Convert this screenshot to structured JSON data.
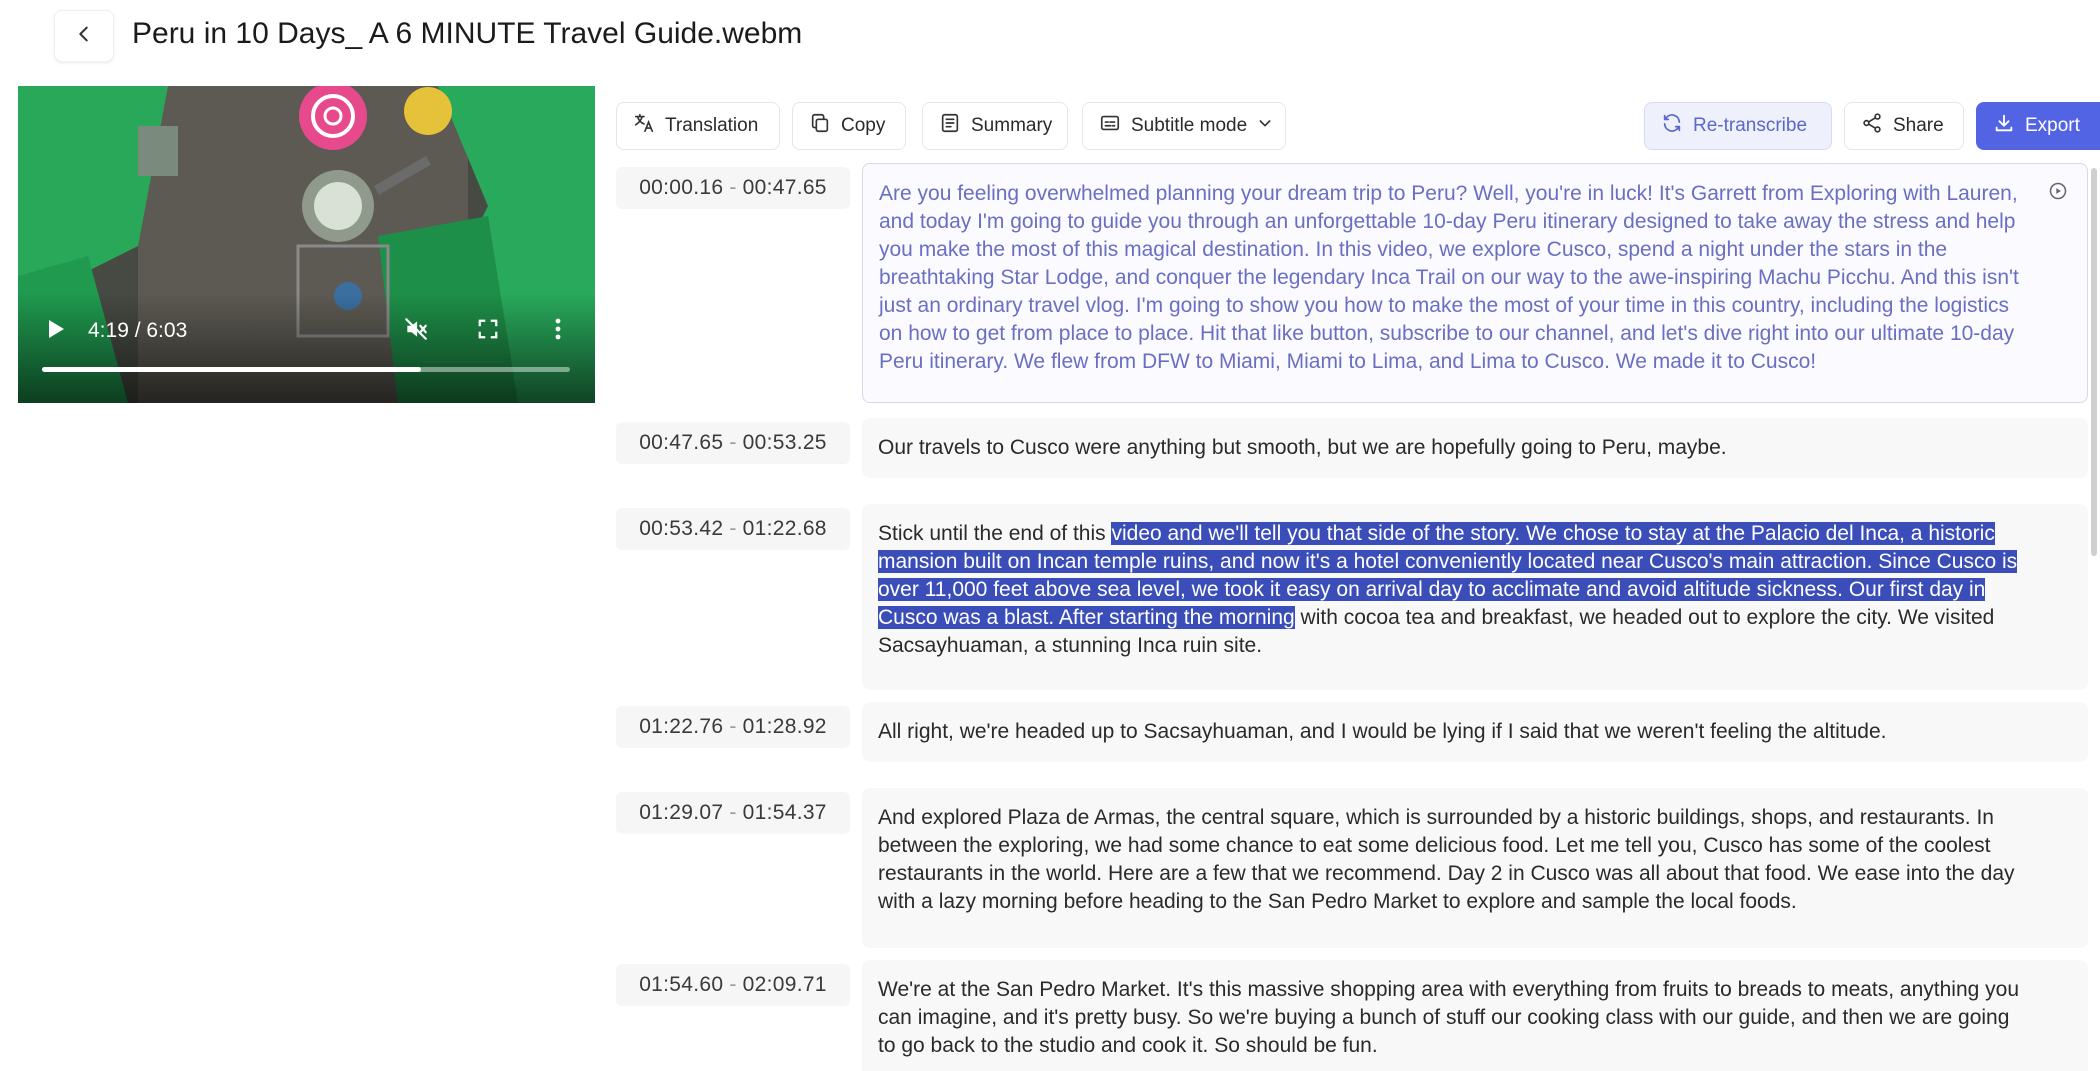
{
  "header": {
    "title": "Peru in 10 Days_ A 6 MINUTE Travel Guide.webm"
  },
  "player": {
    "time": "4:19 / 6:03",
    "progress": 0.717
  },
  "toolbar": {
    "translation": "Translation",
    "copy": "Copy",
    "summary": "Summary",
    "subtitle_mode": "Subtitle mode",
    "retranscribe": "Re-transcribe",
    "share": "Share",
    "export": "Export"
  },
  "colors": {
    "accent": "#5264e4",
    "active_text": "#6a6fc2",
    "highlight": "#3b4db8"
  },
  "segments": [
    {
      "start": "00:00.16",
      "end": "00:47.65",
      "active": true,
      "text": "Are you feeling overwhelmed planning your dream trip to Peru? Well, you're in luck! It's Garrett from Exploring with Lauren, and today I'm going to guide you through an unforgettable 10-day Peru itinerary designed to take away the stress and help you make the most of this magical destination. In this video, we explore Cusco, spend a night under the stars in the breathtaking Star Lodge, and conquer the legendary Inca Trail on our way to the awe-inspiring Machu Picchu. And this isn't just an ordinary travel vlog. I'm going to show you how to make the most of your time in this country, including the logistics on how to get from place to place. Hit that like button, subscribe to our channel, and let's dive right into our ultimate 10-day Peru itinerary. We flew from DFW to Miami, Miami to Lima, and Lima to Cusco. We made it to Cusco!"
    },
    {
      "start": "00:47.65",
      "end": "00:53.25",
      "text": "Our travels to Cusco were anything but smooth, but we are hopefully going to Peru, maybe."
    },
    {
      "start": "00:53.42",
      "end": "01:22.68",
      "text_before": "Stick until the end of this ",
      "text_selected": "video and we'll tell you that side of the story. We chose to stay at the Palacio del Inca, a historic mansion built on Incan temple ruins, and now it's a hotel conveniently located near Cusco's main attraction. Since Cusco is over 11,000 feet above sea level, we took it easy on arrival day to acclimate and avoid altitude sickness. Our first day in Cusco was a blast. After starting the morning",
      "text_after": " with cocoa tea and breakfast, we headed out to explore the city. We visited Sacsayhuaman, a stunning Inca ruin site."
    },
    {
      "start": "01:22.76",
      "end": "01:28.92",
      "text": "All right, we're headed up to Sacsayhuaman, and I would be lying if I said that we weren't feeling the altitude."
    },
    {
      "start": "01:29.07",
      "end": "01:54.37",
      "text": "And explored Plaza de Armas, the central square, which is surrounded by a historic buildings, shops, and restaurants. In between the exploring, we had some chance to eat some delicious food. Let me tell you, Cusco has some of the coolest restaurants in the world. Here are a few that we recommend. Day 2 in Cusco was all about that food. We ease into the day with a lazy morning before heading to the San Pedro Market to explore and sample the local foods."
    },
    {
      "start": "01:54.60",
      "end": "02:09.71",
      "text": "We're at the San Pedro Market. It's this massive shopping area with everything from fruits to breads to meats, anything you can imagine, and it's pretty busy. So we're buying a bunch of stuff our cooking class with our guide, and then we are going to go back to the studio and cook it. So should be fun."
    }
  ]
}
